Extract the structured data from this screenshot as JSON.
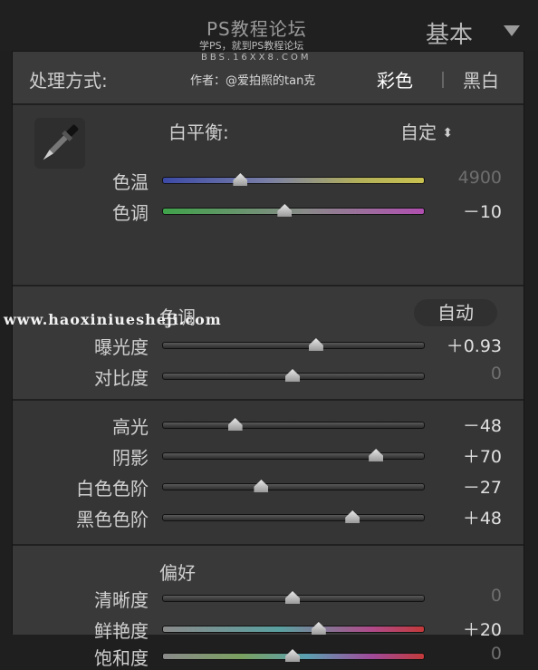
{
  "watermark": {
    "title": "PS教程论坛",
    "line1": "学PS，就到PS教程论坛",
    "line2": "BBS.16XX8.COM",
    "line3": "作者：@爱拍照的tan克",
    "overlay": "www.haoxiniueshejі.com"
  },
  "panel": {
    "title": "基本",
    "collapse_icon": "triangle-down-icon"
  },
  "treatment": {
    "label": "处理方式:",
    "options": [
      "彩色",
      "黑白"
    ],
    "selected": "彩色"
  },
  "white_balance": {
    "label": "白平衡:",
    "value": "自定",
    "icon": "eyedropper-icon",
    "sliders": [
      {
        "label": "色温",
        "value": "4900",
        "position": 0.3,
        "dim": true,
        "style": "temp"
      },
      {
        "label": "色调",
        "value": "－10",
        "position": 0.47,
        "dim": false,
        "style": "tint"
      }
    ]
  },
  "tone": {
    "header": "色调",
    "auto_label": "自动",
    "sliders": [
      {
        "label": "曝光度",
        "value": "＋0.93",
        "position": 0.59,
        "dim": false
      },
      {
        "label": "对比度",
        "value": "0",
        "position": 0.5,
        "dim": true
      },
      {
        "label": "高光",
        "value": "－48",
        "position": 0.28,
        "dim": false
      },
      {
        "label": "阴影",
        "value": "＋70",
        "position": 0.82,
        "dim": false
      },
      {
        "label": "白色色阶",
        "value": "－27",
        "position": 0.38,
        "dim": false
      },
      {
        "label": "黑色色阶",
        "value": "＋48",
        "position": 0.73,
        "dim": false
      }
    ]
  },
  "presence": {
    "header": "偏好",
    "sliders": [
      {
        "label": "清晰度",
        "value": "0",
        "position": 0.5,
        "dim": true,
        "style": ""
      },
      {
        "label": "鲜艳度",
        "value": "＋20",
        "position": 0.6,
        "dim": false,
        "style": "vib"
      },
      {
        "label": "饱和度",
        "value": "0",
        "position": 0.5,
        "dim": true,
        "style": "sat"
      }
    ]
  }
}
